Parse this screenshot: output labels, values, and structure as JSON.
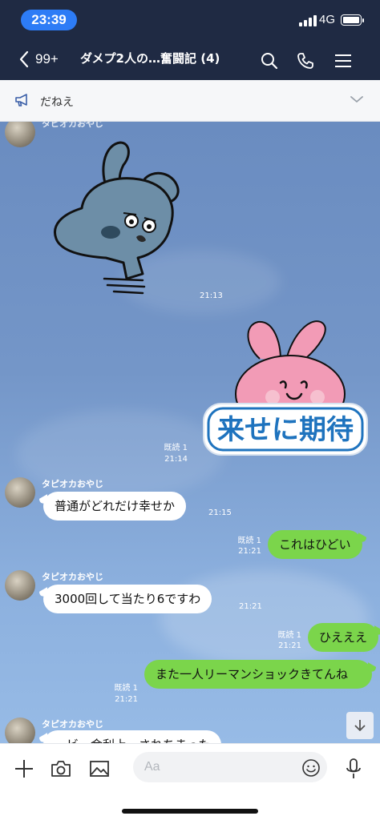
{
  "status_bar": {
    "time": "23:39",
    "network": "4G"
  },
  "header": {
    "unread_count": "99+",
    "title": "ダメプ2人の…奮闘記 (4)"
  },
  "announcement": {
    "text": "だねえ"
  },
  "chat": {
    "stickers": [
      {
        "type": "sticker",
        "description_icon": "blue-creature-sticker",
        "time": "21:13"
      },
      {
        "type": "sticker",
        "description_icon": "pink-rabbit-sticker",
        "text": "来せに期待",
        "read": "既読 1",
        "time": "21:14"
      }
    ],
    "messages": [
      {
        "sender": "タピオカおやじ",
        "text": "普通がどれだけ幸せか",
        "time": "21:15"
      },
      {
        "text": "これはひどい",
        "read": "既読 1",
        "time": "21:21"
      },
      {
        "sender": "タピオカおやじ",
        "text": "3000回して当たり6ですわ",
        "time": "21:21"
      },
      {
        "text": "ひえええ",
        "read": "既読 1",
        "time": "21:21"
      },
      {
        "text": "また一人リーマンショックきてんね",
        "read": "既読 1",
        "time": "21:21"
      },
      {
        "sender": "タピオカおやじ",
        "text": "…ビ…金利上…されちまった"
      }
    ]
  },
  "input": {
    "placeholder": "Aa"
  },
  "colors": {
    "header_bg": "#1f2a43",
    "outgoing_bubble": "#7bd54b",
    "incoming_bubble": "#ffffff",
    "time_pill": "#2d7cf6"
  },
  "icons": [
    "chevron-left-icon",
    "search-icon",
    "phone-icon",
    "menu-icon",
    "megaphone-icon",
    "chevron-down-icon",
    "plus-icon",
    "camera-icon",
    "image-icon",
    "emoji-icon",
    "mic-icon",
    "arrow-down-icon"
  ]
}
